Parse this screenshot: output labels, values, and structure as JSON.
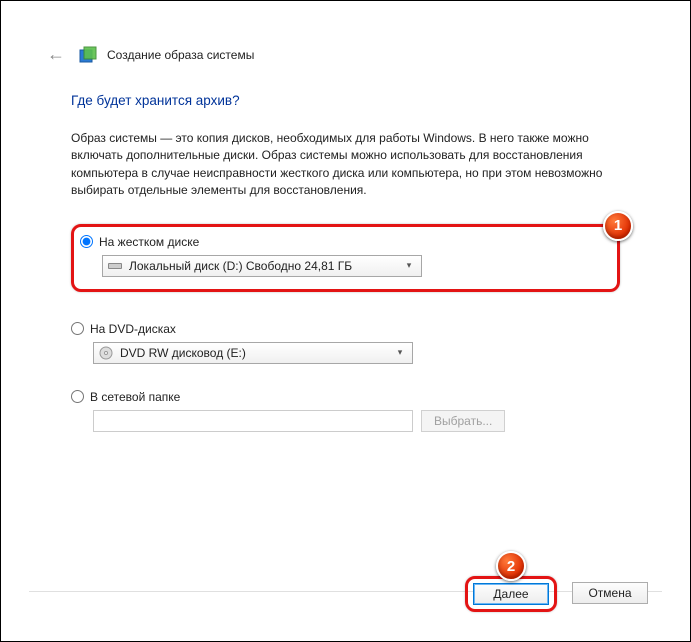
{
  "header": {
    "title": "Создание образа системы"
  },
  "main": {
    "heading": "Где будет хранится архив?",
    "description": "Образ системы — это копия дисков, необходимых для работы Windows. В него также можно включать дополнительные диски. Образ системы можно использовать для восстановления компьютера в случае неисправности жесткого диска или компьютера, но при этом невозможно выбирать отдельные элементы для восстановления."
  },
  "options": {
    "hdd": {
      "label": "На жестком диске",
      "selected": "Локальный диск (D:)  Свободно 24,81 ГБ"
    },
    "dvd": {
      "label": "На DVD-дисках",
      "selected": "DVD RW дисковод (E:)"
    },
    "network": {
      "label": "В сетевой папке",
      "browse": "Выбрать...",
      "value": ""
    }
  },
  "footer": {
    "next": "Далее",
    "cancel": "Отмена"
  },
  "callouts": {
    "one": "1",
    "two": "2"
  }
}
